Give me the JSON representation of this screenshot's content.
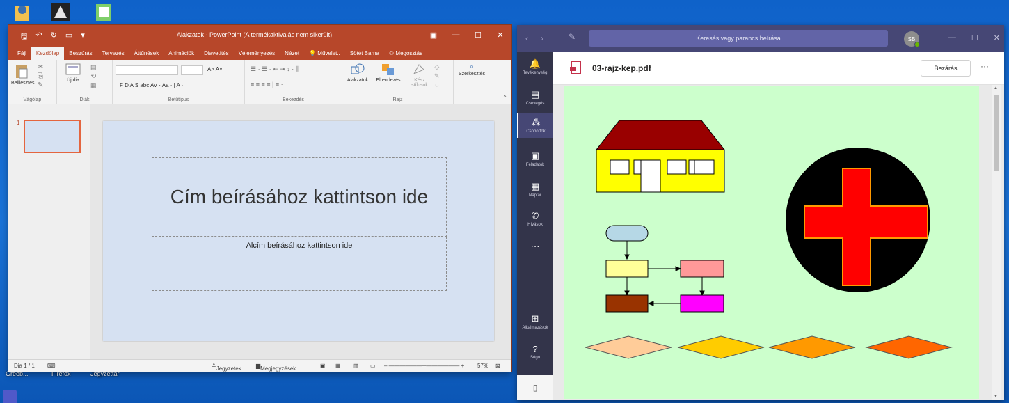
{
  "desktop": {
    "icons": [
      {
        "label": "Greeb...",
        "name": "desktop-icon-1"
      },
      {
        "label": "Firefox",
        "name": "desktop-icon-firefox"
      },
      {
        "label": "Jegyzettár",
        "name": "desktop-icon-3"
      }
    ]
  },
  "powerpoint": {
    "window_title": "Alakzatok - PowerPoint (A termékaktiválás nem sikerült)",
    "tabs": [
      "Fájl",
      "Kezdőlap",
      "Beszúrás",
      "Tervezés",
      "Áttűnések",
      "Animációk",
      "Diavetítés",
      "Véleményezés",
      "Nézet",
      "Művelet..",
      "Sötét Barna",
      "Megosztás"
    ],
    "active_tab": "Kezdőlap",
    "ribbon": {
      "paste_label": "Beillesztés",
      "clipboard_group": "Vágólap",
      "new_slide_label": "Új dia",
      "slides_group": "Diák",
      "font_group": "Betűtípus",
      "font_buttons": "F  D  A  S  abc  AV ·  Aa ·  |  A ·",
      "paragraph_group": "Bekezdés",
      "shapes_label": "Alakzatok",
      "arrange_label": "Elrendezés",
      "styles_label": "Kész stílusok",
      "drawing_group": "Rajz",
      "editing_label": "Szerkesztés"
    },
    "thumbnail_number": "1",
    "slide": {
      "title_placeholder": "Cím beírásához kattintson ide",
      "subtitle_placeholder": "Alcím beírásához kattintson ide"
    },
    "status": {
      "slide_counter": "Dia 1 / 1",
      "notes": "Jegyzetek",
      "comments": "Megjegyzések",
      "zoom": "57%"
    },
    "colors": {
      "accent": "#b7472a",
      "slide_bg": "#d6e1f2"
    }
  },
  "teams": {
    "search_placeholder": "Keresés vagy parancs beírása",
    "avatar_initials": "SB",
    "rail": [
      {
        "label": "Tevékenység",
        "icon": "bell-icon",
        "glyph": "🔔"
      },
      {
        "label": "Csevegés",
        "icon": "chat-icon",
        "glyph": "▤"
      },
      {
        "label": "Csoportok",
        "icon": "teams-icon",
        "glyph": "⁂"
      },
      {
        "label": "Feladatok",
        "icon": "assignments-icon",
        "glyph": "▣"
      },
      {
        "label": "Naptár",
        "icon": "calendar-icon",
        "glyph": "▦"
      },
      {
        "label": "Hívások",
        "icon": "phone-icon",
        "glyph": "✆"
      },
      {
        "label": "",
        "icon": "more-icon",
        "glyph": "···"
      },
      {
        "label": "Alkalmazások",
        "icon": "apps-icon",
        "glyph": "⊞"
      },
      {
        "label": "Súgó",
        "icon": "help-icon",
        "glyph": "?"
      }
    ],
    "file_name": "03-rajz-kep.pdf",
    "close_label": "Bezárás",
    "more_label": "···",
    "colors": {
      "brand": "#464775",
      "rail": "#33344a",
      "page_bg": "#ccffcc"
    }
  },
  "drawing": {
    "house": {
      "roof_color": "#990000",
      "wall_color": "#ffff00",
      "window_color": "#ffffff"
    },
    "flowchart": {
      "start_color": "#b6d8e6",
      "step1_color": "#ffff99",
      "step2_color": "#ff9999",
      "step3_color": "#993300",
      "step4_color": "#ff00ff"
    },
    "red_cross": {
      "circle_color": "#000000",
      "cross_color": "#ff0000",
      "cross_outline": "#ff9900"
    },
    "diamonds": [
      "#ffcc99",
      "#ffcc00",
      "#ff9900",
      "#ff6600"
    ]
  }
}
